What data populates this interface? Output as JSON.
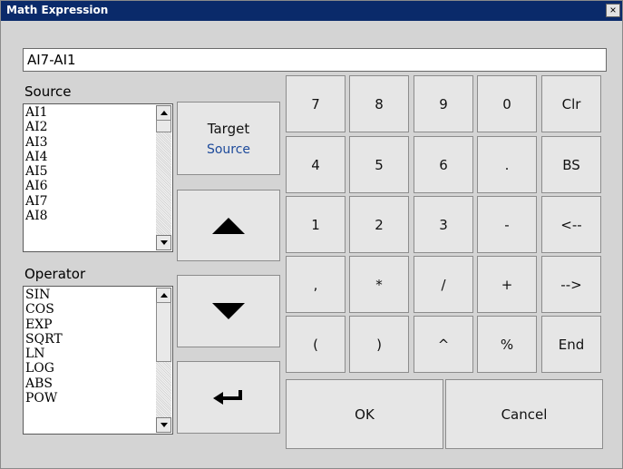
{
  "window": {
    "title": "Math Expression",
    "close_glyph": "×"
  },
  "expression": {
    "value": "AI7-AI1"
  },
  "source": {
    "label": "Source",
    "items": [
      "AI1",
      "AI2",
      "AI3",
      "AI4",
      "AI5",
      "AI6",
      "AI7",
      "AI8"
    ]
  },
  "operator": {
    "label": "Operator",
    "items": [
      "SIN",
      "COS",
      "EXP",
      "SQRT",
      "LN",
      "LOG",
      "ABS",
      "POW"
    ]
  },
  "toggle": {
    "target": "Target",
    "source": "Source"
  },
  "keypad": {
    "keys": [
      "7",
      "8",
      "9",
      "0",
      "Clr",
      "4",
      "5",
      "6",
      ".",
      "BS",
      "1",
      "2",
      "3",
      "-",
      "<--",
      ",",
      "*",
      "/",
      "+",
      "-->",
      "(",
      ")",
      "^",
      "%",
      "End"
    ],
    "ok": "OK",
    "cancel": "Cancel"
  },
  "colors": {
    "titlebar": "#0a2a6a",
    "source_toggle_text": "#1d4a9b"
  }
}
